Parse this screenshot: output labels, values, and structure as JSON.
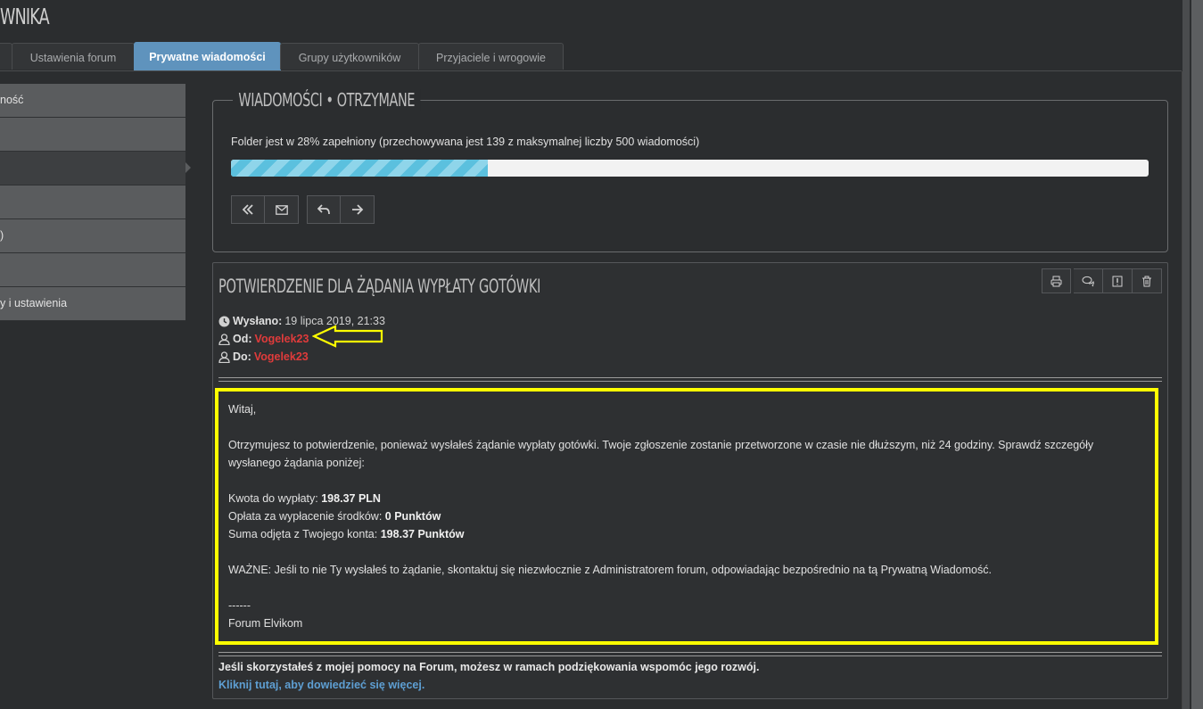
{
  "page_title": "WNIKA",
  "tabs": [
    {
      "label": "Ustawienia forum"
    },
    {
      "label": "Prywatne wiadomości",
      "active": true
    },
    {
      "label": "Grupy użytkowników"
    },
    {
      "label": "Przyjaciele i wrogowie"
    }
  ],
  "sidebar": {
    "items": [
      {
        "label": "ność"
      },
      {
        "label": ""
      },
      {
        "label": "",
        "active": true
      },
      {
        "label": ""
      },
      {
        "label": ")"
      },
      {
        "label": ""
      },
      {
        "label": "y i ustawienia"
      }
    ]
  },
  "folder": {
    "legend": "WIADOMOŚCI • OTRZYMANE",
    "quota_text": "Folder jest w 28% zapełniony (przechowywana jest 139 z maksymalnej liczby 500 wiadomości)",
    "quota_percent": 28,
    "nav_icons": [
      "double-left-icon",
      "envelope-icon",
      "reply-icon",
      "arrow-right-icon"
    ]
  },
  "message": {
    "title": "POTWIERDZENIE DLA ŻĄDANIA WYPŁATY GOTÓWKI",
    "tool_icons": [
      "print-icon",
      "quote-icon",
      "report-icon",
      "trash-icon"
    ],
    "sent_label": "Wysłano:",
    "sent_value": "19 lipca 2019, 21:33",
    "from_label": "Od:",
    "from_user": "Vogelek23",
    "to_label": "Do:",
    "to_user": "Vogelek23",
    "greeting": "Witaj,",
    "intro": "Otrzymujesz to potwierdzenie, ponieważ wysłałeś żądanie wypłaty gotówki. Twoje zgłoszenie zostanie przetworzone w czasie nie dłuższym, niż 24 godziny. Sprawdź szczegóły wysłanego żądania poniżej:",
    "amount_label": "Kwota do wypłaty:",
    "amount_value": "198.37 PLN",
    "fee_label": "Opłata za wypłacenie środków:",
    "fee_value": "0 Punktów",
    "total_label": "Suma odjęta z Twojego konta:",
    "total_value": "198.37 Punktów",
    "important": "WAŻNE: Jeśli to nie Ty wysłałeś to żądanie, skontaktuj się niezwłocznie z Administratorem forum, odpowiadając bezpośrednio na tą Prywatną Wiadomość.",
    "sig_dashes": "------",
    "sig_name": "Forum Elvikom",
    "footer_text": "Jeśli skorzystałeś z mojej pomocy na Forum, możesz w ramach podziękowania wspomóc jego rozwój.",
    "footer_link": "Kliknij tutaj, aby dowiedzieć się więcej."
  },
  "colors": {
    "background": "#2b2d2f",
    "active_tab": "#5f93bd",
    "username": "#e03b3b",
    "link": "#5e9fd3",
    "highlight": "#ffff00"
  }
}
